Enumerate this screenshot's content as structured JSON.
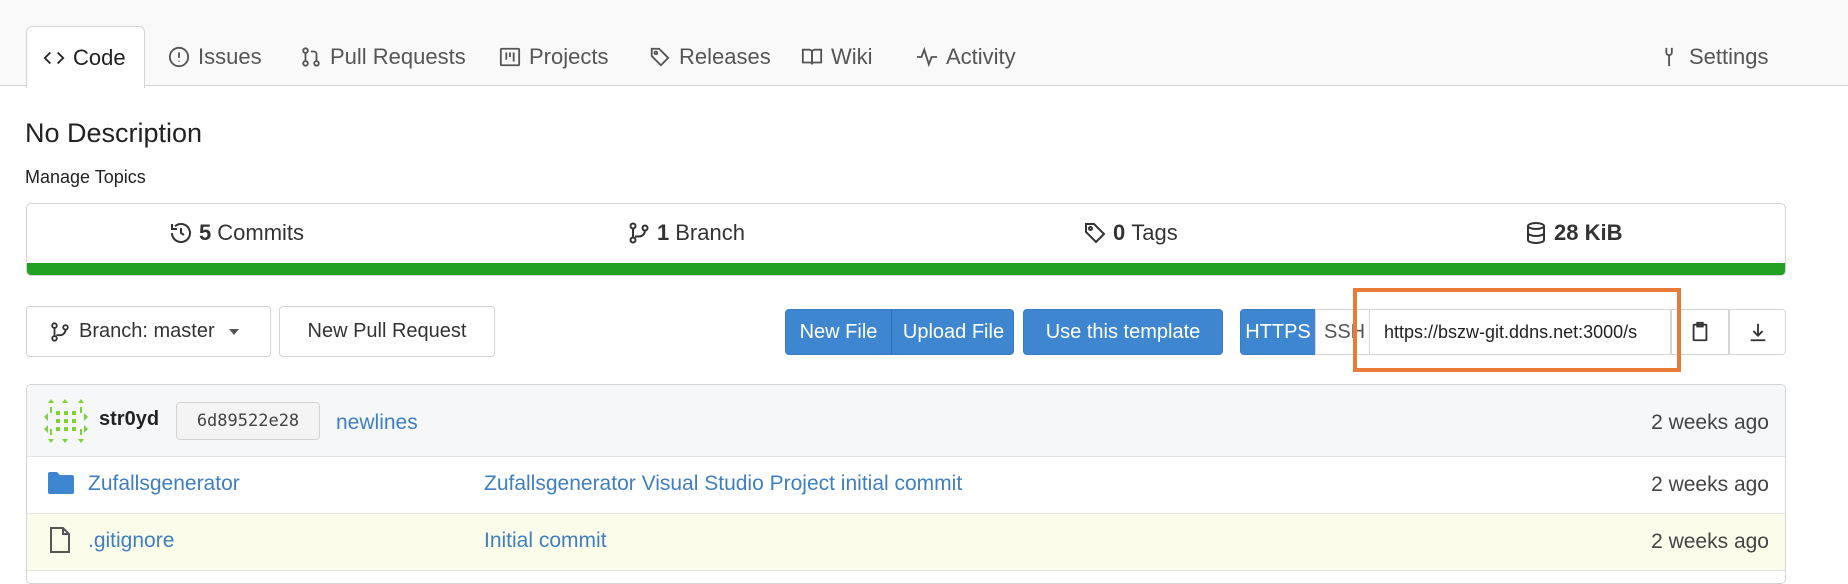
{
  "tabs": [
    {
      "label": "Code",
      "icon": "code-icon"
    },
    {
      "label": "Issues",
      "icon": "issue-icon"
    },
    {
      "label": "Pull Requests",
      "icon": "pull-request-icon"
    },
    {
      "label": "Projects",
      "icon": "project-icon"
    },
    {
      "label": "Releases",
      "icon": "tag-icon"
    },
    {
      "label": "Wiki",
      "icon": "book-icon"
    },
    {
      "label": "Activity",
      "icon": "pulse-icon"
    },
    {
      "label": "Settings",
      "icon": "tools-icon"
    }
  ],
  "repo": {
    "description": "No Description",
    "manage_topics": "Manage Topics"
  },
  "stats": {
    "commits": {
      "count": "5",
      "label": "Commits"
    },
    "branches": {
      "count": "1",
      "label": "Branch"
    },
    "tags": {
      "count": "0",
      "label": "Tags"
    },
    "size": "28 KiB",
    "language_bar_color": "#21a021"
  },
  "toolbar": {
    "branch_label": "Branch: master",
    "new_pull_request": "New Pull Request",
    "new_file": "New File",
    "upload_file": "Upload File",
    "use_template": "Use this template",
    "https": "HTTPS",
    "ssh": "SSH",
    "clone_url": "https://bszw-git.ddns.net:3000/s"
  },
  "latest_commit": {
    "author": "str0yd",
    "sha": "6d89522e28",
    "message": "newlines",
    "time": "2 weeks ago"
  },
  "files": [
    {
      "name": "Zufallsgenerator",
      "type": "folder",
      "message": "Zufallsgenerator Visual Studio Project initial commit",
      "time": "2 weeks ago"
    },
    {
      "name": ".gitignore",
      "type": "file",
      "message": "Initial commit",
      "time": "2 weeks ago"
    }
  ],
  "colors": {
    "accent": "#3f86d0",
    "highlight": "#ea7a37",
    "link": "#3f7fc0"
  }
}
